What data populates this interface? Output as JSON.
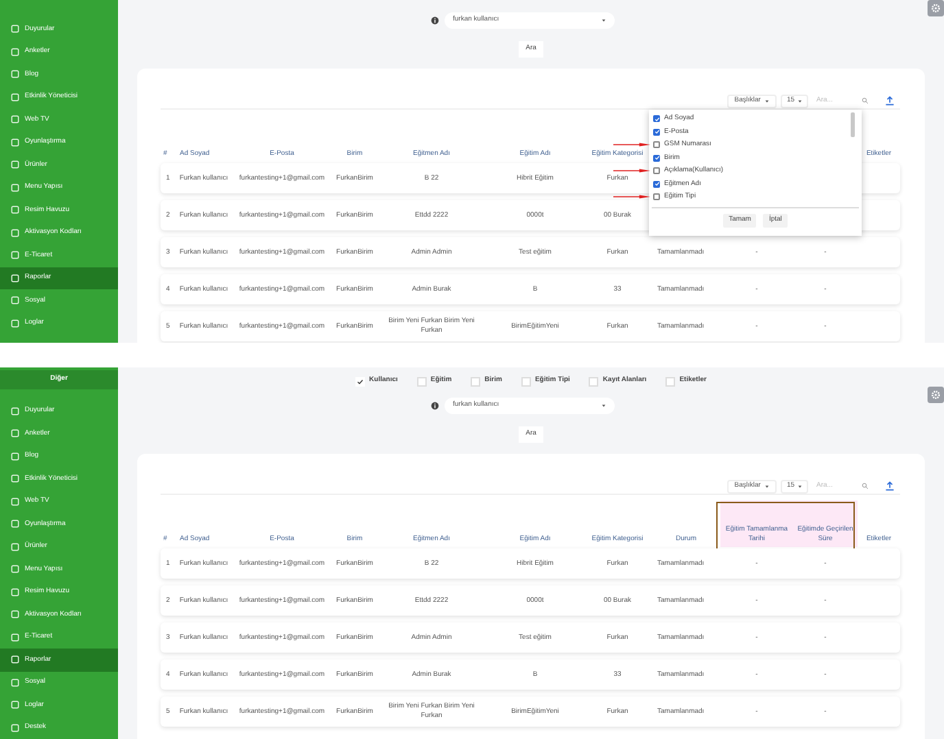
{
  "panels": [
    {
      "sidebar": {
        "items": [
          {
            "label": "Duyurular",
            "selected": false
          },
          {
            "label": "Anketler",
            "selected": false
          },
          {
            "label": "Blog",
            "selected": false
          },
          {
            "label": "Etkinlik Yöneticisi",
            "selected": false
          },
          {
            "label": "Web TV",
            "selected": false
          },
          {
            "label": "Oyunlaştırma",
            "selected": false
          },
          {
            "label": "Ürünler",
            "selected": false
          },
          {
            "label": "Menu Yapısı",
            "selected": false
          },
          {
            "label": "Resim Havuzu",
            "selected": false
          },
          {
            "label": "Aktivasyon Kodları",
            "selected": false
          },
          {
            "label": "E-Ticaret",
            "selected": false
          },
          {
            "label": "Raporlar",
            "selected": true
          },
          {
            "label": "Sosyal",
            "selected": false
          },
          {
            "label": "Loglar",
            "selected": false
          }
        ]
      },
      "user_select": {
        "value": "furkan kullanıcı"
      },
      "search_button": "Ara",
      "toolbar": {
        "columns_button": "Başlıklar",
        "page_size": "15",
        "search_placeholder": "Ara..."
      },
      "columns": [
        {
          "label": "#"
        },
        {
          "label": "Ad Soyad"
        },
        {
          "label": "E-Posta"
        },
        {
          "label": "Birim"
        },
        {
          "label": "Eğitmen Adı"
        },
        {
          "label": "Eğitim Adı"
        },
        {
          "label": "Eğitim Kategorisi"
        },
        null,
        null,
        null,
        {
          "label": "Etiketler"
        }
      ],
      "rows": [
        {
          "cells": [
            "1",
            "Furkan kullanıcı",
            "furkantesting+1@gmail.com",
            "FurkanBirim",
            "B 22",
            "Hibrit Eğitim",
            "Furkan",
            null,
            null,
            null
          ]
        },
        {
          "cells": [
            "2",
            "Furkan kullanıcı",
            "furkantesting+1@gmail.com",
            "FurkanBirim",
            "Ettdd 2222",
            "0000t",
            "00 Burak",
            null,
            null,
            null
          ]
        },
        {
          "cells": [
            "3",
            "Furkan kullanıcı",
            "furkantesting+1@gmail.com",
            "FurkanBirim",
            "Admin Admin",
            "Test eğitim",
            "Furkan",
            "Tamamlanmadı",
            "-",
            "-"
          ]
        },
        {
          "cells": [
            "4",
            "Furkan kullanıcı",
            "furkantesting+1@gmail.com",
            "FurkanBirim",
            "Admin Burak",
            "B",
            "33",
            "Tamamlanmadı",
            "-",
            "-"
          ]
        },
        {
          "cells": [
            "5",
            "Furkan kullanıcı",
            "furkantesting+1@gmail.com",
            "FurkanBirim",
            "Birim Yeni Furkan Birim Yeni Furkan",
            "BirimEğitimYeni",
            "Furkan",
            "Tamamlanmadı",
            "-",
            "-"
          ]
        }
      ],
      "column_menu": {
        "options": [
          {
            "label": "Ad Soyad",
            "checked": true,
            "arrow": false
          },
          {
            "label": "E-Posta",
            "checked": true,
            "arrow": false
          },
          {
            "label": "GSM Numarası",
            "checked": false,
            "arrow": true
          },
          {
            "label": "Birim",
            "checked": true,
            "arrow": false
          },
          {
            "label": "Açıklama(Kullanıcı)",
            "checked": false,
            "arrow": true
          },
          {
            "label": "Eğitmen Adı",
            "checked": true,
            "arrow": false
          },
          {
            "label": "Eğitim Tipi",
            "checked": false,
            "arrow": true
          }
        ],
        "buttons": [
          "Tamam",
          "İptal"
        ]
      }
    },
    {
      "sidebar": {
        "header": "Diğer",
        "items": [
          {
            "label": "Duyurular",
            "selected": false
          },
          {
            "label": "Anketler",
            "selected": false
          },
          {
            "label": "Blog",
            "selected": false
          },
          {
            "label": "Etkinlik Yöneticisi",
            "selected": false
          },
          {
            "label": "Web TV",
            "selected": false
          },
          {
            "label": "Oyunlaştırma",
            "selected": false
          },
          {
            "label": "Ürünler",
            "selected": false
          },
          {
            "label": "Menu Yapısı",
            "selected": false
          },
          {
            "label": "Resim Havuzu",
            "selected": false
          },
          {
            "label": "Aktivasyon Kodları",
            "selected": false
          },
          {
            "label": "E-Ticaret",
            "selected": false
          },
          {
            "label": "Raporlar",
            "selected": true
          },
          {
            "label": "Sosyal",
            "selected": false
          },
          {
            "label": "Loglar",
            "selected": false
          },
          {
            "label": "Destek",
            "selected": false
          }
        ]
      },
      "filters": [
        {
          "label": "Kullanıcı",
          "checked": true
        },
        {
          "label": "Eğitim",
          "checked": false
        },
        {
          "label": "Birim",
          "checked": false
        },
        {
          "label": "Eğitim Tipi",
          "checked": false
        },
        {
          "label": "Kayıt Alanları",
          "checked": false
        },
        {
          "label": "Etiketler",
          "checked": false
        }
      ],
      "user_select": {
        "value": "furkan kullanıcı"
      },
      "search_button": "Ara",
      "toolbar": {
        "columns_button": "Başlıklar",
        "page_size": "15",
        "search_placeholder": "Ara..."
      },
      "columns": [
        {
          "label": "#",
          "highlighted": false
        },
        {
          "label": "Ad Soyad",
          "highlighted": false
        },
        {
          "label": "E-Posta",
          "highlighted": false
        },
        {
          "label": "Birim",
          "highlighted": false
        },
        {
          "label": "Eğitmen Adı",
          "highlighted": false
        },
        {
          "label": "Eğitim Adı",
          "highlighted": false
        },
        {
          "label": "Eğitim Kategorisi",
          "highlighted": false
        },
        {
          "label": "Durum",
          "highlighted": false
        },
        {
          "label": "Eğitim Tamamlanma Tarihi",
          "highlighted": true
        },
        {
          "label": "Eğitimde Geçirilen Süre",
          "highlighted": true
        },
        {
          "label": "Etiketler",
          "highlighted": false
        }
      ],
      "rows": [
        {
          "cells": [
            "1",
            "Furkan kullanıcı",
            "furkantesting+1@gmail.com",
            "FurkanBirim",
            "B 22",
            "Hibrit Eğitim",
            "Furkan",
            "Tamamlanmadı",
            "-",
            "-"
          ]
        },
        {
          "cells": [
            "2",
            "Furkan kullanıcı",
            "furkantesting+1@gmail.com",
            "FurkanBirim",
            "Ettdd 2222",
            "0000t",
            "00 Burak",
            "Tamamlanmadı",
            "-",
            "-"
          ]
        },
        {
          "cells": [
            "3",
            "Furkan kullanıcı",
            "furkantesting+1@gmail.com",
            "FurkanBirim",
            "Admin Admin",
            "Test eğitim",
            "Furkan",
            "Tamamlanmadı",
            "-",
            "-"
          ]
        },
        {
          "cells": [
            "4",
            "Furkan kullanıcı",
            "furkantesting+1@gmail.com",
            "FurkanBirim",
            "Admin Burak",
            "B",
            "33",
            "Tamamlanmadı",
            "-",
            "-"
          ]
        },
        {
          "cells": [
            "5",
            "Furkan kullanıcı",
            "furkantesting+1@gmail.com",
            "FurkanBirim",
            "Birim Yeni Furkan Birim Yeni Furkan",
            "BirimEğitimYeni",
            "Furkan",
            "Tamamlanmadı",
            "-",
            "-"
          ]
        }
      ]
    }
  ]
}
